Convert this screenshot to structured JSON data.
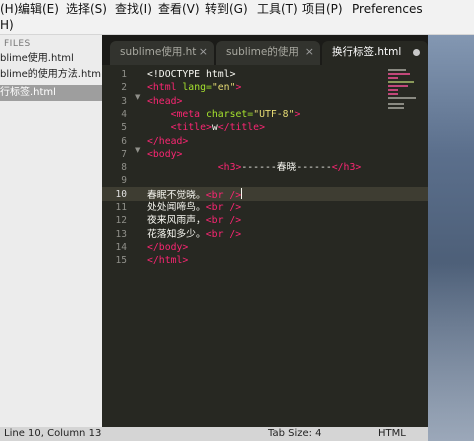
{
  "menu": {
    "items": [
      "(H)",
      "编辑(E)",
      "选择(S)",
      "查找(I)",
      "查看(V)",
      "转到(G)",
      "工具(T)",
      "项目(P)",
      "Preferences"
    ],
    "wrapped_help": "H)"
  },
  "sidebar": {
    "header": "FILES",
    "files": [
      "blime使用.html",
      "blime的使用方法.htm",
      "行标签.html"
    ],
    "active_index": 2
  },
  "tabs": [
    {
      "label": "sublime使用.ht",
      "close": "×"
    },
    {
      "label": "sublime的使用",
      "close": "×"
    },
    {
      "label": "换行标签.html",
      "modified": true
    }
  ],
  "editor": {
    "line_numbers": [
      "1",
      "2",
      "3",
      "4",
      "5",
      "6",
      "7",
      "8",
      "9",
      "10",
      "11",
      "12",
      "13",
      "14",
      "15"
    ],
    "current_line": 10
  },
  "code": {
    "l1": "<!DOCTYPE html>",
    "l2_tag_open": "<html",
    "l2_attr": " lang=",
    "l2_str": "\"en\"",
    "l2_tag_close": ">",
    "l3": "<head>",
    "l4_tag_open": "<meta",
    "l4_attr": " charset=",
    "l4_str": "\"UTF-8\"",
    "l4_tag_close": ">",
    "l5_tag_open": "<title>",
    "l5_text": "w",
    "l5_tag_close": "</title>",
    "l6": "</head>",
    "l7": "<body>",
    "l8_tag_open": "<h3>",
    "l8_text": "------春晓------",
    "l8_tag_close": "</h3>",
    "l10_text": "春眠不觉晓。",
    "l10_tag": "<br />",
    "l11_text": "处处闻啼鸟。",
    "l11_tag": "<br />",
    "l12_text": "夜来风雨声，",
    "l12_tag": "<br />",
    "l13_text": "花落知多少。",
    "l13_tag": "<br />",
    "l14": "</body>",
    "l15": "</html>"
  },
  "status": {
    "position": "Line 10, Column 13",
    "tab_size": "Tab Size: 4",
    "syntax": "HTML"
  },
  "colors": {
    "editor_bg": "#272822",
    "tag": "#f92672",
    "attribute": "#a6e22e",
    "string": "#e6db74",
    "text": "#f8f8f2"
  }
}
